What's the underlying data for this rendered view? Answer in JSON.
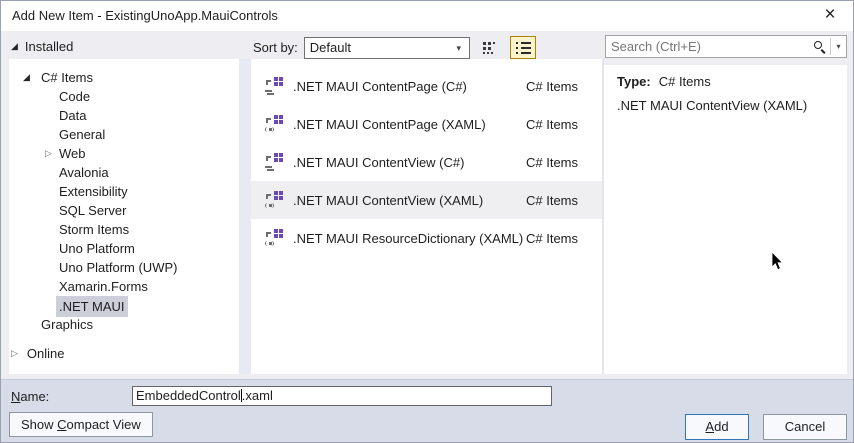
{
  "window": {
    "title": "Add New Item - ExistingUnoApp.MauiControls"
  },
  "icons": {
    "expanded": "◢",
    "collapsed": "▷",
    "combo_arrow": "▾",
    "search_dropdown_arrow": "▾",
    "close": "×"
  },
  "left_panel": {
    "installed_label": "Installed",
    "online_label": "Online",
    "tree": [
      {
        "label": "C# Items"
      },
      {
        "label": "Code"
      },
      {
        "label": "Data"
      },
      {
        "label": "General"
      },
      {
        "label": "Web"
      },
      {
        "label": "Avalonia"
      },
      {
        "label": "Extensibility"
      },
      {
        "label": "SQL Server"
      },
      {
        "label": "Storm Items"
      },
      {
        "label": "Uno Platform"
      },
      {
        "label": "Uno Platform (UWP)"
      },
      {
        "label": "Xamarin.Forms"
      },
      {
        "label": ".NET MAUI"
      },
      {
        "label": "Graphics"
      }
    ],
    "selected_item": ".NET MAUI"
  },
  "toolbar": {
    "sort_by_label": "Sort by:",
    "sort_value": "Default"
  },
  "search": {
    "placeholder": "Search (Ctrl+E)"
  },
  "templates": {
    "rows": [
      {
        "name": ".NET MAUI ContentPage (C#)",
        "category": "C# Items"
      },
      {
        "name": ".NET MAUI ContentPage (XAML)",
        "category": "C# Items"
      },
      {
        "name": ".NET MAUI ContentView (C#)",
        "category": "C# Items"
      },
      {
        "name": ".NET MAUI ContentView (XAML)",
        "category": "C# Items"
      },
      {
        "name": ".NET MAUI ResourceDictionary (XAML)",
        "category": "C# Items"
      }
    ],
    "selected_row": ".NET MAUI ContentView (XAML)"
  },
  "details": {
    "type_label": "Type:",
    "type_value": "C# Items",
    "description": ".NET MAUI ContentView (XAML)"
  },
  "footer": {
    "name_label_key": "N",
    "name_label_rest": "ame:",
    "name_value_before_caret": "EmbeddedControl",
    "name_value_after_caret": ".xaml",
    "compact_pre": "Show ",
    "compact_key": "C",
    "compact_rest": "ompact View",
    "add_key": "A",
    "add_rest": "dd",
    "cancel_label": "Cancel"
  },
  "colors": {
    "selection_gray": "#ccceda",
    "active_view_button_bg": "#fdf4cd",
    "active_view_button_border": "#ab8300",
    "default_button_border": "#3277b5",
    "icon_purple": "#6a49b8"
  }
}
